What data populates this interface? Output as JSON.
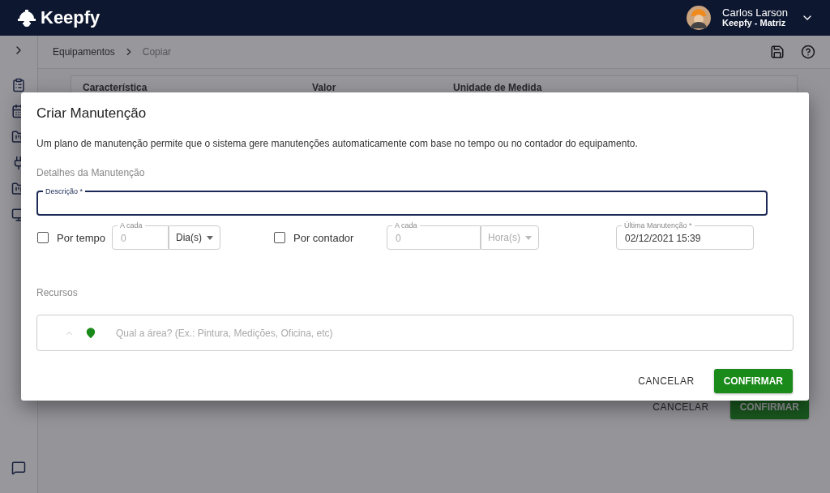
{
  "header": {
    "brand": "Keepfy",
    "user": {
      "name": "Carlos Larson",
      "org": "Keepfy - Matriz"
    }
  },
  "breadcrumb": [
    {
      "label": "Equipamentos",
      "current": false
    },
    {
      "label": "Copiar",
      "current": true
    }
  ],
  "table": {
    "columns": [
      "Característica",
      "Valor",
      "Unidade de Medida"
    ]
  },
  "page_buttons": {
    "cancel": "CANCELAR",
    "confirm": "CONFIRMAR"
  },
  "dialog": {
    "title": "Criar Manutenção",
    "description": "Um plano de manutenção permite que o sistema gere manutenções automaticamente com base no tempo ou no contador do equipamento.",
    "section": "Detalhes da Manutenção",
    "description_field": {
      "label": "Descrição *"
    },
    "triggers": [
      {
        "label": "Por tempo",
        "checked": false,
        "interval": {
          "label": "A cada",
          "placeholder": "0"
        },
        "unit": {
          "value": "Dia(s)",
          "disabled": false
        }
      },
      {
        "label": "Por contador",
        "checked": false,
        "interval": {
          "label": "A cada",
          "placeholder": "0"
        },
        "unit": {
          "value": "Hora(s)",
          "disabled": true
        }
      }
    ],
    "last_maintenance": {
      "label": "Última Manutenção *",
      "value": "02/12/2021 15:39"
    },
    "resources_label": "Recursos",
    "area": {
      "placeholder": "Qual a área? (Ex.: Pintura, Medições, Oficina, etc)"
    },
    "buttons": {
      "cancel": "CANCELAR",
      "confirm": "CONFIRMAR"
    }
  }
}
